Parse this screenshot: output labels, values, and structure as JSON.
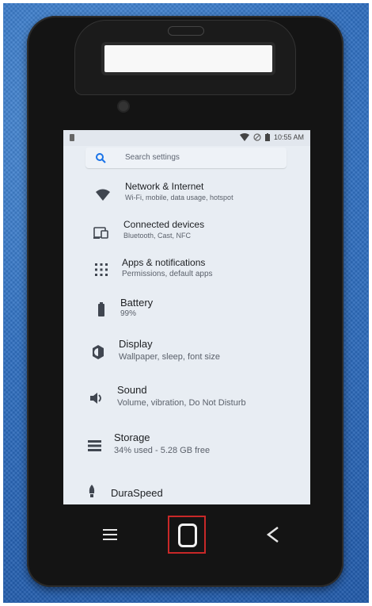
{
  "status": {
    "time": "10:55 AM"
  },
  "search": {
    "placeholder": "Search settings"
  },
  "items": [
    {
      "title": "Network & Internet",
      "subtitle": "Wi-Fi, mobile, data usage, hotspot",
      "icon": "wifi-icon"
    },
    {
      "title": "Connected devices",
      "subtitle": "Bluetooth, Cast, NFC",
      "icon": "devices-icon"
    },
    {
      "title": "Apps & notifications",
      "subtitle": "Permissions, default apps",
      "icon": "apps-grid-icon"
    },
    {
      "title": "Battery",
      "subtitle": "99%",
      "icon": "battery-icon"
    },
    {
      "title": "Display",
      "subtitle": "Wallpaper, sleep, font size",
      "icon": "brightness-icon"
    },
    {
      "title": "Sound",
      "subtitle": "Volume, vibration, Do Not Disturb",
      "icon": "speaker-icon"
    },
    {
      "title": "Storage",
      "subtitle": "34% used - 5.28 GB free",
      "icon": "storage-icon"
    },
    {
      "title": "DuraSpeed",
      "subtitle": "",
      "icon": "rocket-icon"
    }
  ],
  "nav": {
    "menu": "menu-icon",
    "home": "home-icon",
    "back": "back-icon"
  },
  "colors": {
    "screen_bg": "#e8edf3",
    "accent": "#1a73e8",
    "highlight": "#c82828"
  }
}
